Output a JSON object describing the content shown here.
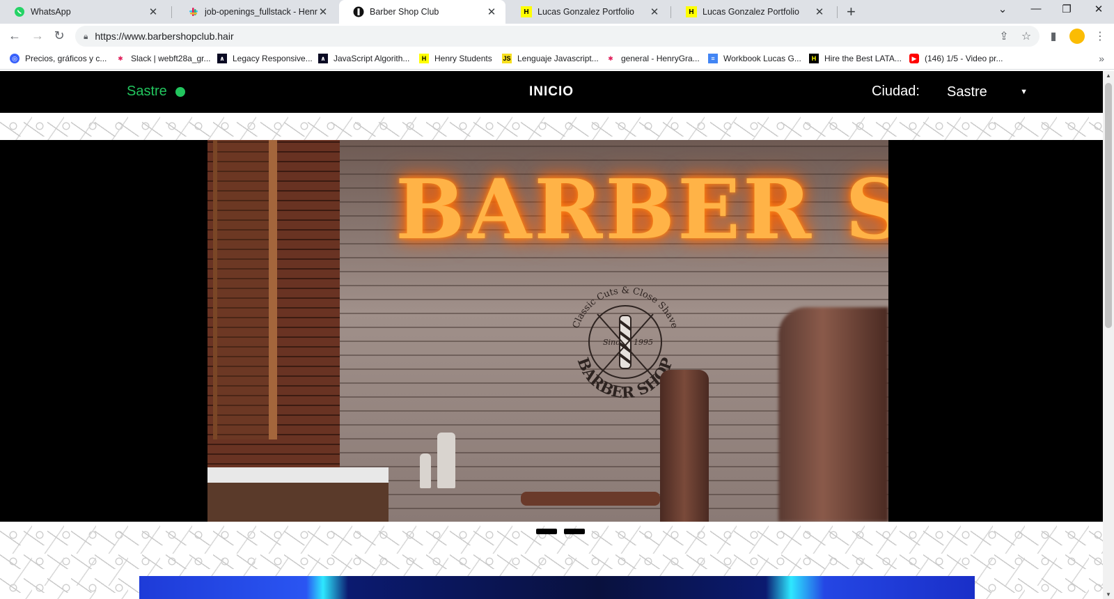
{
  "browser": {
    "tabs": [
      {
        "title": "WhatsApp",
        "icon": "whatsapp-icon",
        "color": "#25d366"
      },
      {
        "title": "job-openings_fullstack - HenryGr",
        "icon": "slack-icon",
        "color": "#e01e5a"
      },
      {
        "title": "Barber Shop Club",
        "icon": "barber-shop-icon",
        "color": "#000000",
        "active": true
      },
      {
        "title": "Lucas Gonzalez Portfolio",
        "icon": "henry-icon",
        "color": "#ffff01"
      },
      {
        "title": "Lucas Gonzalez Portfolio",
        "icon": "henry-icon",
        "color": "#ffff01"
      }
    ],
    "url": "https://www.barbershopclub.hair",
    "bookmarks": [
      {
        "label": "Precios, gráficos y c...",
        "icon": "coinmarketcap-icon",
        "color": "#3861fb"
      },
      {
        "label": "Slack | webft28a_gr...",
        "icon": "slack-icon",
        "color": "#e01e5a"
      },
      {
        "label": "Legacy Responsive...",
        "icon": "freecodecamp-icon",
        "color": "#0a0a23"
      },
      {
        "label": "JavaScript Algorith...",
        "icon": "freecodecamp-icon",
        "color": "#0a0a23"
      },
      {
        "label": "Henry Students",
        "icon": "henry-icon",
        "color": "#ffff01"
      },
      {
        "label": "Lenguaje Javascript...",
        "icon": "js-icon",
        "color": "#f7df1e"
      },
      {
        "label": "general - HenryGra...",
        "icon": "slack-icon",
        "color": "#e01e5a"
      },
      {
        "label": "Workbook Lucas G...",
        "icon": "google-docs-icon",
        "color": "#4285f4"
      },
      {
        "label": "Hire the Best LATA...",
        "icon": "henry-icon",
        "color": "#ffff01"
      },
      {
        "label": "(146) 1/5 - Video pr...",
        "icon": "youtube-icon",
        "color": "#ff0000"
      }
    ]
  },
  "site": {
    "brand": "Sastre",
    "brand_color": "#22c55e",
    "nav_home": "INICIO",
    "city_label": "Ciudad:",
    "city_selected": "Sastre"
  },
  "hero": {
    "neon_text": "BARBER SHOP",
    "emblem_top": "Classic Cuts & Close Shave",
    "emblem_since": "Since",
    "emblem_year": "1995",
    "emblem_bottom": "BARBER SHOP",
    "slides": 2
  }
}
